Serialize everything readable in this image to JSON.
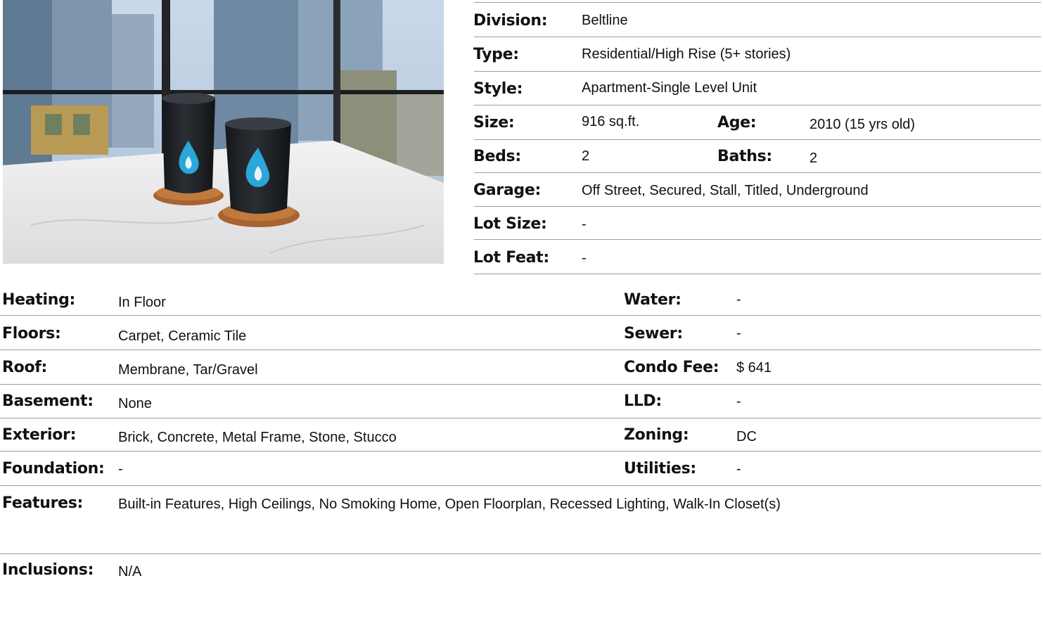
{
  "photo": {
    "alt_icon": "branded-tumbler-photo",
    "colors": {
      "tumbler": "#1f2226",
      "drop": "#2aa7d8",
      "coaster": "#b36a2f",
      "counter": "#e8e9ea",
      "sky": "#b7cbe0"
    }
  },
  "top_details": {
    "division": {
      "label": "Division:",
      "value": "Beltline"
    },
    "type": {
      "label": "Type:",
      "value": "Residential/High Rise (5+ stories)"
    },
    "style": {
      "label": "Style:",
      "value": "Apartment-Single Level Unit"
    },
    "size": {
      "label": "Size:",
      "value": "916 sq.ft."
    },
    "age": {
      "label": "Age:",
      "value": "2010 (15 yrs old)"
    },
    "beds": {
      "label": "Beds:",
      "value": "2"
    },
    "baths": {
      "label": "Baths:",
      "value": "2"
    },
    "garage": {
      "label": "Garage:",
      "value": "Off Street, Secured, Stall, Titled, Underground"
    },
    "lot_size": {
      "label": "Lot Size:",
      "value": "-"
    },
    "lot_feat": {
      "label": "Lot Feat:",
      "value": "-"
    }
  },
  "left_details": {
    "heating": {
      "label": "Heating:",
      "value": "In Floor"
    },
    "floors": {
      "label": "Floors:",
      "value": "Carpet, Ceramic Tile"
    },
    "roof": {
      "label": "Roof:",
      "value": "Membrane, Tar/Gravel"
    },
    "basement": {
      "label": "Basement:",
      "value": "None"
    },
    "exterior": {
      "label": "Exterior:",
      "value": "Brick, Concrete, Metal Frame, Stone, Stucco"
    },
    "foundation": {
      "label": "Foundation:",
      "value": "-"
    }
  },
  "right_details": {
    "water": {
      "label": "Water:",
      "value": "-"
    },
    "sewer": {
      "label": "Sewer:",
      "value": "-"
    },
    "condo_fee": {
      "label": "Condo Fee:",
      "value": "$ 641"
    },
    "lld": {
      "label": "LLD:",
      "value": "-"
    },
    "zoning": {
      "label": "Zoning:",
      "value": "DC"
    },
    "utilities": {
      "label": "Utilities:",
      "value": "-"
    }
  },
  "features": {
    "label": "Features:",
    "value": "Built-in Features, High Ceilings, No Smoking Home, Open Floorplan, Recessed Lighting, Walk-In Closet(s)"
  },
  "inclusions": {
    "label": "Inclusions:",
    "value": "N/A"
  }
}
